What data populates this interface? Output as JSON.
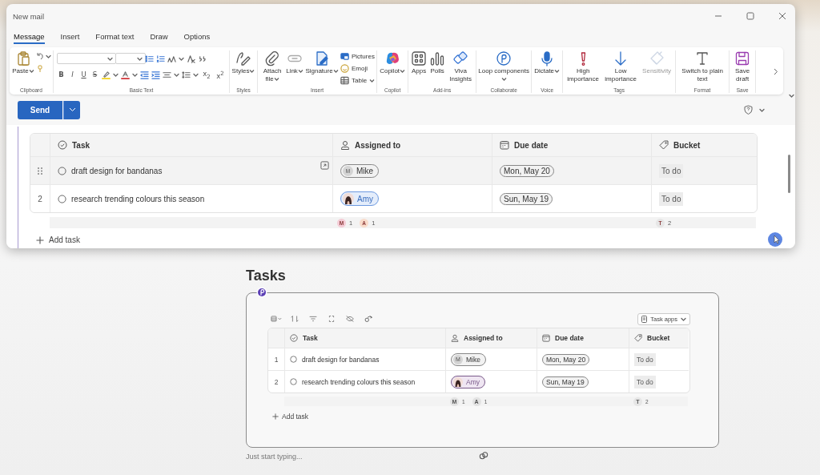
{
  "mail_window": {
    "title": "New mail",
    "tabs": [
      {
        "label": "Message",
        "selected": true
      },
      {
        "label": "Insert",
        "selected": false
      },
      {
        "label": "Format text",
        "selected": false
      },
      {
        "label": "Draw",
        "selected": false
      },
      {
        "label": "Options",
        "selected": false
      }
    ],
    "ribbon": [
      {
        "kind": "clipboard",
        "label": "Clipboard",
        "buttons": [
          {
            "kind": "large",
            "label": "Paste",
            "caret": true,
            "disabled": false
          }
        ]
      },
      {
        "kind": "basic_text",
        "label": "Basic Text",
        "letters": [
          "B",
          "I",
          "U",
          "S"
        ],
        "scripts": [
          "x$_{2}$",
          "x$^{2}$"
        ]
      },
      {
        "kind": "buttons",
        "label": "Styles",
        "buttons": [
          {
            "kind": "large",
            "label": "Styles",
            "caret": true,
            "disabled": false
          }
        ]
      },
      {
        "kind": "buttons",
        "label": "Insert",
        "buttons": [
          {
            "kind": "large",
            "label": "Attach file",
            "caret": true,
            "disabled": false
          },
          {
            "kind": "large",
            "label": "Link",
            "caret": true,
            "disabled": false
          },
          {
            "kind": "large",
            "label": "Signature",
            "caret": true,
            "disabled": false
          },
          {
            "kind": "small",
            "label": "Pictures",
            "caret": false,
            "disabled": false
          },
          {
            "kind": "small",
            "label": "Emoji",
            "caret": false,
            "disabled": false
          },
          {
            "kind": "small",
            "label": "Table",
            "caret": true,
            "disabled": false
          }
        ]
      },
      {
        "kind": "buttons",
        "label": "Copilot",
        "buttons": [
          {
            "kind": "large",
            "label": "Copilot",
            "caret": true,
            "disabled": false
          }
        ]
      },
      {
        "kind": "buttons",
        "label": "Add-ins",
        "buttons": [
          {
            "kind": "large",
            "label": "Apps",
            "caret": false,
            "disabled": false
          },
          {
            "kind": "large",
            "label": "Polls",
            "caret": false,
            "disabled": false
          },
          {
            "kind": "large",
            "label": "Viva Insights",
            "caret": false,
            "disabled": false
          }
        ]
      },
      {
        "kind": "buttons",
        "label": "Collaborate",
        "buttons": [
          {
            "kind": "large",
            "label": "Loop components",
            "caret": true,
            "disabled": false
          }
        ]
      },
      {
        "kind": "buttons",
        "label": "Voice",
        "buttons": [
          {
            "kind": "large",
            "label": "Dictate",
            "caret": true,
            "disabled": false
          }
        ]
      },
      {
        "kind": "buttons",
        "label": "Tags",
        "buttons": [
          {
            "kind": "large",
            "label": "High importance",
            "caret": false,
            "disabled": false
          },
          {
            "kind": "large",
            "label": "Low importance",
            "caret": false,
            "disabled": false
          },
          {
            "kind": "large",
            "label": "Sensitivity",
            "caret": false,
            "disabled": true
          }
        ]
      },
      {
        "kind": "buttons",
        "label": "Format",
        "buttons": [
          {
            "kind": "large",
            "label": "Switch to plain text",
            "caret": false,
            "disabled": false
          }
        ]
      },
      {
        "kind": "buttons",
        "label": "Save",
        "buttons": [
          {
            "kind": "large",
            "label": "Save draft",
            "caret": false,
            "disabled": false
          }
        ]
      }
    ],
    "send_button": "Send",
    "table": {
      "columns": [
        "Task",
        "Assigned to",
        "Due date",
        "Bucket"
      ],
      "rows": [
        {
          "hovered": true,
          "done": false,
          "task": "draft design for bandanas",
          "assignee": {
            "kind": "initials",
            "initial": "M",
            "name": "Mike",
            "highlighted": false
          },
          "due": "Mon, May 20",
          "bucket": "To do"
        },
        {
          "hovered": false,
          "number": "2",
          "done": false,
          "task": "research trending colours this season",
          "assignee": {
            "kind": "photo",
            "name": "Amy",
            "highlighted": true
          },
          "due": "Sun, May 19",
          "bucket": "To do"
        }
      ],
      "assignee_summary": [
        {
          "initial": "M",
          "count": "1",
          "color": "#f4cbd5"
        },
        {
          "initial": "A",
          "count": "1",
          "color": "#f9dccb"
        }
      ],
      "bucket_summary": [
        {
          "initial": "T",
          "count": "2"
        }
      ],
      "add_task": "Add task"
    }
  },
  "loop_page": {
    "heading": "Tasks",
    "task_apps_button": "Task apps",
    "table": {
      "columns": [
        "Task",
        "Assigned to",
        "Due date",
        "Bucket"
      ],
      "rows": [
        {
          "hovered": false,
          "number": "1",
          "done": false,
          "task": "draft design for bandanas",
          "assignee": {
            "kind": "initials",
            "initial": "M",
            "name": "Mike",
            "highlighted": false
          },
          "due": "Mon, May 20",
          "bucket": "To do"
        },
        {
          "hovered": false,
          "number": "2",
          "done": false,
          "task": "research trending colours this season",
          "assignee": {
            "kind": "photo",
            "name": "Amy",
            "highlighted": true
          },
          "due": "Sun, May 19",
          "bucket": "To do"
        }
      ],
      "assignee_summary": [
        {
          "initial": "M",
          "count": "1"
        },
        {
          "initial": "A",
          "count": "1"
        }
      ],
      "bucket_summary": [
        {
          "initial": "T",
          "count": "2"
        }
      ],
      "add_task": "Add task"
    },
    "placeholder": "Just start typing..."
  }
}
